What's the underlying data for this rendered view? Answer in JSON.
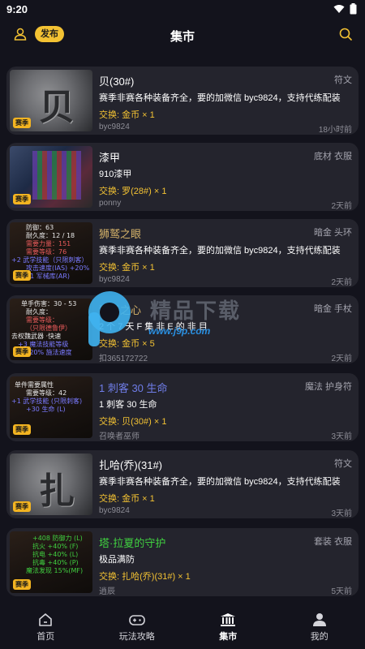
{
  "status": {
    "time": "9:20"
  },
  "header": {
    "publish_label": "发布",
    "title": "集市"
  },
  "colors": {
    "accent": "#f3c233",
    "background": "#13131c",
    "card": "#24242d"
  },
  "listings": [
    {
      "title": "贝(30#)",
      "tags": "符文",
      "desc": "赛季非赛各种装备齐全，要的加微信 byc9824，支持代练配装",
      "trade": "交换: 金币 × 1",
      "user": "byc9824",
      "time": "18小时前",
      "badge": "赛季",
      "rune": "贝"
    },
    {
      "title": "漆甲",
      "tags": "底材 衣服",
      "desc": "910漆甲",
      "trade": "交换: 罗(28#) × 1",
      "user": "ponny",
      "time": "2天前",
      "badge": "赛季"
    },
    {
      "title": "狮鹫之眼",
      "tags": "暗金 头环",
      "desc": "赛季非赛各种装备齐全，要的加微信 byc9824，支持代练配装",
      "trade": "交换: 金币 × 1",
      "user": "byc9824",
      "time": "2天前",
      "badge": "赛季",
      "thumb_lines": [
        "防御：63",
        "耐久度：12 / 18",
        "需要力量：151",
        "需要等级：76",
        "+2 武学技能（只限刺客）",
        "攻击速度(IAS) +20%",
        "11 军械库(AR)"
      ]
    },
    {
      "title": "狮子之心",
      "tags": "暗金 手杖",
      "desc": "2  个  7  天  F  集  非  E  的  非  目",
      "trade": "交换: 金币 × 5",
      "user": "扣365172722",
      "time": "2天前",
      "badge": "赛季",
      "thumb_lines": [
        "单手伤害：30 - 53",
        "耐久度：",
        "需要等级：",
        "（只限德鲁伊）",
        "去权魏武器 ·快速",
        "+3 魔法技能等级",
        "+3 20% 施法速度",
        "攻击速度 ·"
      ]
    },
    {
      "title": "1 刺客 30 生命",
      "tags": "魔法 护身符",
      "desc": "1 刺客 30 生命",
      "trade": "交换: 贝(30#) × 1",
      "user": "召唤者巫师",
      "time": "3天前",
      "badge": "赛季",
      "thumb_lines": [
        "单件需要属性",
        "需要等级：42",
        "+1 武学技能 (只限刺客)",
        "+30 生命 (L)"
      ]
    },
    {
      "title": "扎哈(乔)(31#)",
      "tags": "符文",
      "desc": "赛季非赛各种装备齐全，要的加微信 byc9824，支持代练配装",
      "trade": "交换: 金币 × 1",
      "user": "byc9824",
      "time": "3天前",
      "badge": "赛季",
      "rune": "扎"
    },
    {
      "title": "塔·拉夏的守护",
      "tags": "套装 衣服",
      "desc": "极品满防",
      "trade": "交换: 扎哈(乔)(31#) × 1",
      "user": "逍辰",
      "time": "5天前",
      "badge": "赛季",
      "thumb_lines": [
        "+408 防御力 (L)",
        "抗火 +40% (F)",
        "抗电 +40% (L)",
        "抗毒 +40% (P)",
        "魔法发现 15%(MF)"
      ]
    }
  ],
  "watermark": {
    "text": "精品下载",
    "url": "www.j9p.com"
  },
  "tabbar": [
    {
      "label": "首页",
      "icon": "home-icon"
    },
    {
      "label": "玩法攻略",
      "icon": "gamepad-icon"
    },
    {
      "label": "集市",
      "icon": "bank-icon",
      "active": true
    },
    {
      "label": "我的",
      "icon": "user-icon"
    }
  ]
}
